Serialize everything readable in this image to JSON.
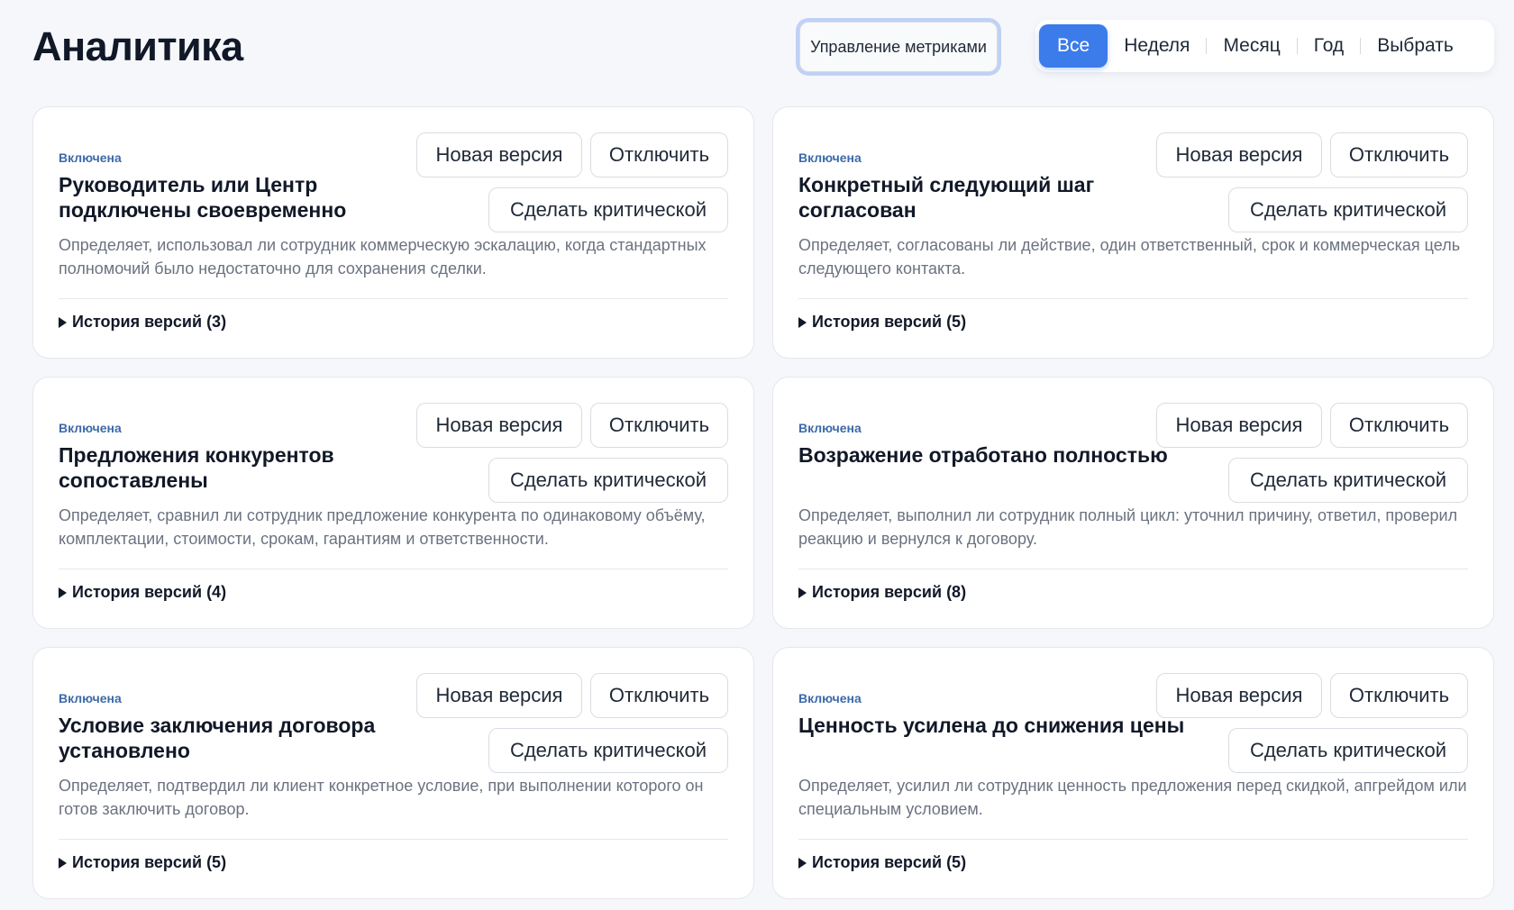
{
  "header": {
    "title": "Аналитика",
    "manage_label": "Управление метриками",
    "tabs": [
      {
        "label": "Все"
      },
      {
        "label": "Неделя"
      },
      {
        "label": "Месяц"
      },
      {
        "label": "Год"
      },
      {
        "label": "Выбрать"
      }
    ]
  },
  "card_labels": {
    "new_version": "Новая версия",
    "disable": "Отключить",
    "make_critical": "Сделать критической"
  },
  "metrics": [
    {
      "status": "Включена",
      "title": "Руководитель или Центр подключены своевременно",
      "description": "Определяет, использовал ли сотрудник коммерческую эскалацию, когда стандартных полномочий было недостаточно для сохранения сделки.",
      "history": "История версий (3)"
    },
    {
      "status": "Включена",
      "title": "Конкретный следующий шаг согласован",
      "description": "Определяет, согласованы ли действие, один ответственный, срок и коммерческая цель следующего контакта.",
      "history": "История версий (5)"
    },
    {
      "status": "Включена",
      "title": "Предложения конкурентов сопоставлены",
      "description": "Определяет, сравнил ли сотрудник предложение конкурента по одинаковому объёму, комплектации, стоимости, срокам, гарантиям и ответственности.",
      "history": "История версий (4)"
    },
    {
      "status": "Включена",
      "title": "Возражение отработано полностью",
      "description": "Определяет, выполнил ли сотрудник полный цикл: уточнил причину, ответил, проверил реакцию и вернулся к договору.",
      "history": "История версий (8)"
    },
    {
      "status": "Включена",
      "title": "Условие заключения договора установлено",
      "description": "Определяет, подтвердил ли клиент конкретное условие, при выполнении которого он готов заключить договор.",
      "history": "История версий (5)"
    },
    {
      "status": "Включена",
      "title": "Ценность усилена до снижения цены",
      "description": "Определяет, усилил ли сотрудник ценность предложения перед скидкой, апгрейдом или специальным условием.",
      "history": "История версий (5)"
    }
  ]
}
